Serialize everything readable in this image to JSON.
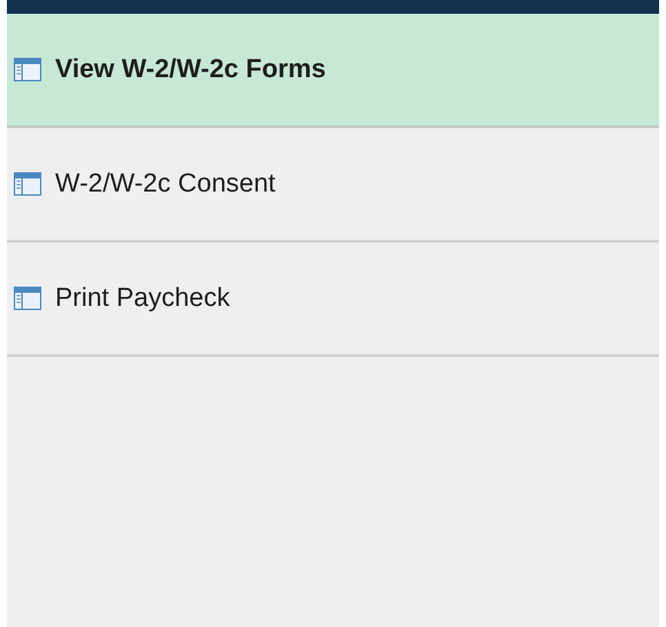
{
  "menu": {
    "items": [
      {
        "label": "View W-2/W-2c Forms",
        "selected": true
      },
      {
        "label": "W-2/W-2c Consent",
        "selected": false
      },
      {
        "label": "Print Paycheck",
        "selected": false
      }
    ]
  }
}
